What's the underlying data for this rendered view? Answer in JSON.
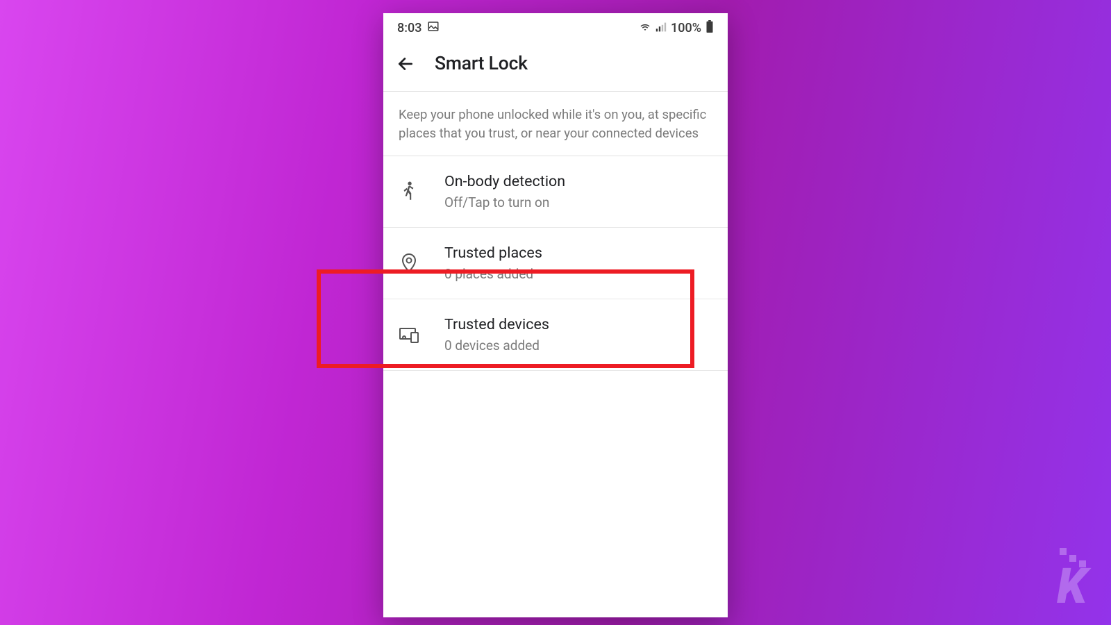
{
  "status_bar": {
    "time": "8:03",
    "battery_percent": "100%"
  },
  "app_bar": {
    "title": "Smart Lock"
  },
  "description": "Keep your phone unlocked while it's on you, at specific places that you trust, or near your connected devices",
  "items": [
    {
      "title": "On-body detection",
      "subtitle": "Off/Tap to turn on"
    },
    {
      "title": "Trusted places",
      "subtitle": "0 places added"
    },
    {
      "title": "Trusted devices",
      "subtitle": "0 devices added"
    }
  ]
}
